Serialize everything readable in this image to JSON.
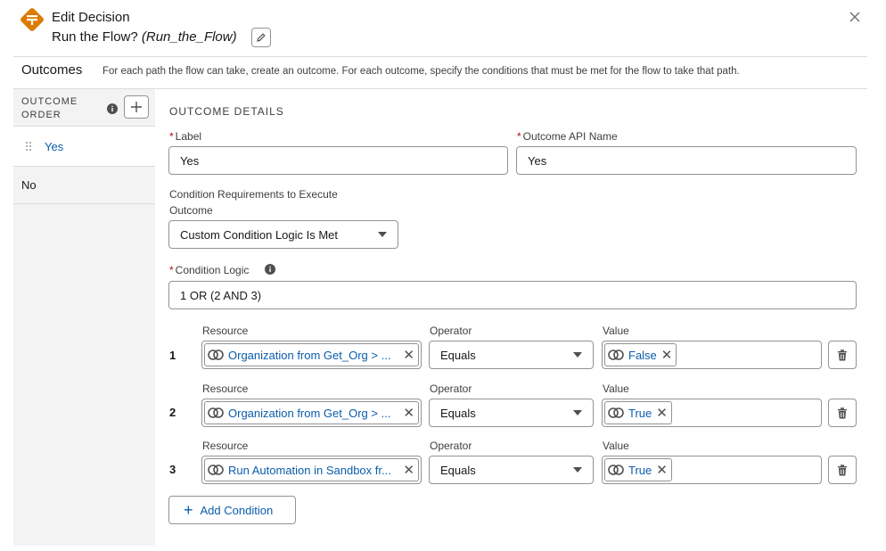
{
  "header": {
    "kind": "Edit Decision",
    "name_prefix": "Run the Flow? ",
    "name_api": "(Run_the_Flow)",
    "accent_color": "#dd7a01"
  },
  "outcomes": {
    "title": "Outcomes",
    "description": "For each path the flow can take, create an outcome. For each outcome, specify the conditions that must be met for the flow to take that path."
  },
  "sidebar": {
    "order_label_line1": "OUTCOME",
    "order_label_line2": "ORDER",
    "items": [
      {
        "label": "Yes",
        "selected": true
      },
      {
        "label": "No",
        "selected": false
      }
    ]
  },
  "details": {
    "title": "OUTCOME DETAILS",
    "label_label": "Label",
    "label_value": "Yes",
    "api_label": "Outcome API Name",
    "api_value": "Yes",
    "cond_req_label": "Condition Requirements to Execute Outcome",
    "cond_req_value": "Custom Condition Logic Is Met",
    "logic_label": "Condition Logic",
    "logic_value": "1 OR (2 AND 3)"
  },
  "conditions": {
    "resource_header": "Resource",
    "operator_header": "Operator",
    "value_header": "Value",
    "rows": [
      {
        "num": "1",
        "resource": "Organization from Get_Org > ...",
        "operator": "Equals",
        "value": "False"
      },
      {
        "num": "2",
        "resource": "Organization from Get_Org > ...",
        "operator": "Equals",
        "value": "True"
      },
      {
        "num": "3",
        "resource": "Run Automation in Sandbox fr...",
        "operator": "Equals",
        "value": "True"
      }
    ],
    "add_label": "Add Condition"
  }
}
